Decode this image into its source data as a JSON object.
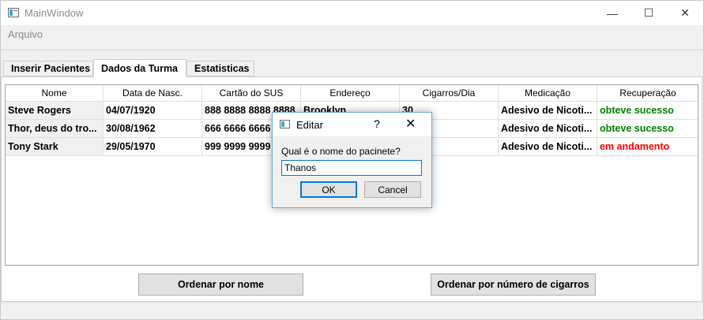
{
  "window": {
    "title": "MainWindow",
    "minimize_glyph": "—",
    "maximize_glyph": "☐",
    "close_glyph": "✕"
  },
  "menu": {
    "items": [
      {
        "label": "Arquivo"
      }
    ]
  },
  "tabs": [
    {
      "label": "Inserir Pacientes",
      "active": false
    },
    {
      "label": "Dados da Turma",
      "active": true
    },
    {
      "label": "Estatisticas",
      "active": false
    }
  ],
  "table": {
    "columns": [
      "Nome",
      "Data de Nasc.",
      "Cartão do SUS",
      "Endereço",
      "Cigarros/Dia",
      "Medicação",
      "Recuperação"
    ],
    "rows": [
      {
        "nome": "Steve Rogers",
        "nasc": "04/07/1920",
        "sus": "888 8888 8888 8888",
        "endereco": "Brooklyn",
        "cigarros": "30",
        "medicacao": "Adesivo de Nicoti...",
        "recuperacao": "obteve sucesso",
        "status_color": "#008000"
      },
      {
        "nome": "Thor, deus do tro...",
        "nasc": "30/08/1962",
        "sus": "666 6666 6666 6666",
        "endereco": "",
        "cigarros": "",
        "medicacao": "Adesivo de Nicoti...",
        "recuperacao": "obteve sucesso",
        "status_color": "#008000"
      },
      {
        "nome": "Tony Stark",
        "nasc": "29/05/1970",
        "sus": "999 9999 9999 9999",
        "endereco": "",
        "cigarros": "",
        "medicacao": "Adesivo de Nicoti...",
        "recuperacao": "em andamento",
        "status_color": "#ff0000"
      }
    ]
  },
  "buttons": {
    "sort_name": "Ordenar por nome",
    "sort_cigarettes": "Ordenar por número de cigarros"
  },
  "dialog": {
    "title": "Editar",
    "help_glyph": "?",
    "close_glyph": "✕",
    "prompt": "Qual é o nome do pacinete?",
    "input_value": "Thanos",
    "ok_label": "OK",
    "cancel_label": "Cancel"
  },
  "colors": {
    "success": "#008000",
    "in_progress": "#ff0000",
    "focus": "#0078d7"
  }
}
